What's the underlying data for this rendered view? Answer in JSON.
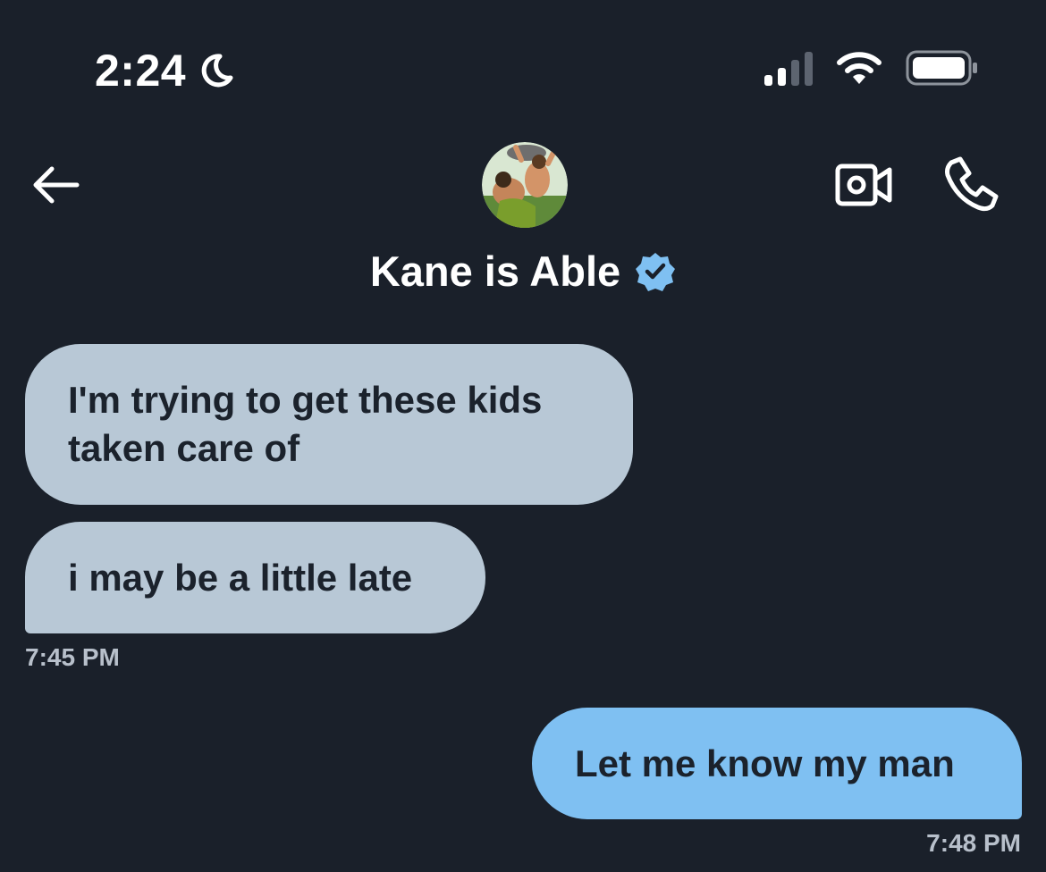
{
  "status_bar": {
    "time": "2:24",
    "icons": [
      "moon-icon",
      "signal-icon",
      "wifi-icon",
      "battery-icon"
    ]
  },
  "header": {
    "contact_name": "Kane is Able",
    "verified": true,
    "actions": [
      "back-arrow-icon",
      "video-call-icon",
      "phone-call-icon"
    ]
  },
  "messages": [
    {
      "direction": "incoming",
      "text": "I'm trying to get these kids taken care of"
    },
    {
      "direction": "incoming",
      "text": "i may be a little late"
    },
    {
      "direction": "outgoing",
      "text": "Let me know my man"
    }
  ],
  "timestamps": {
    "incoming": "7:45 PM",
    "outgoing": "7:48 PM"
  },
  "colors": {
    "background": "#1a202a",
    "incoming_bubble": "#b8c8d6",
    "outgoing_bubble": "#7fc0f2",
    "verified_badge": "#7fc0f2"
  }
}
